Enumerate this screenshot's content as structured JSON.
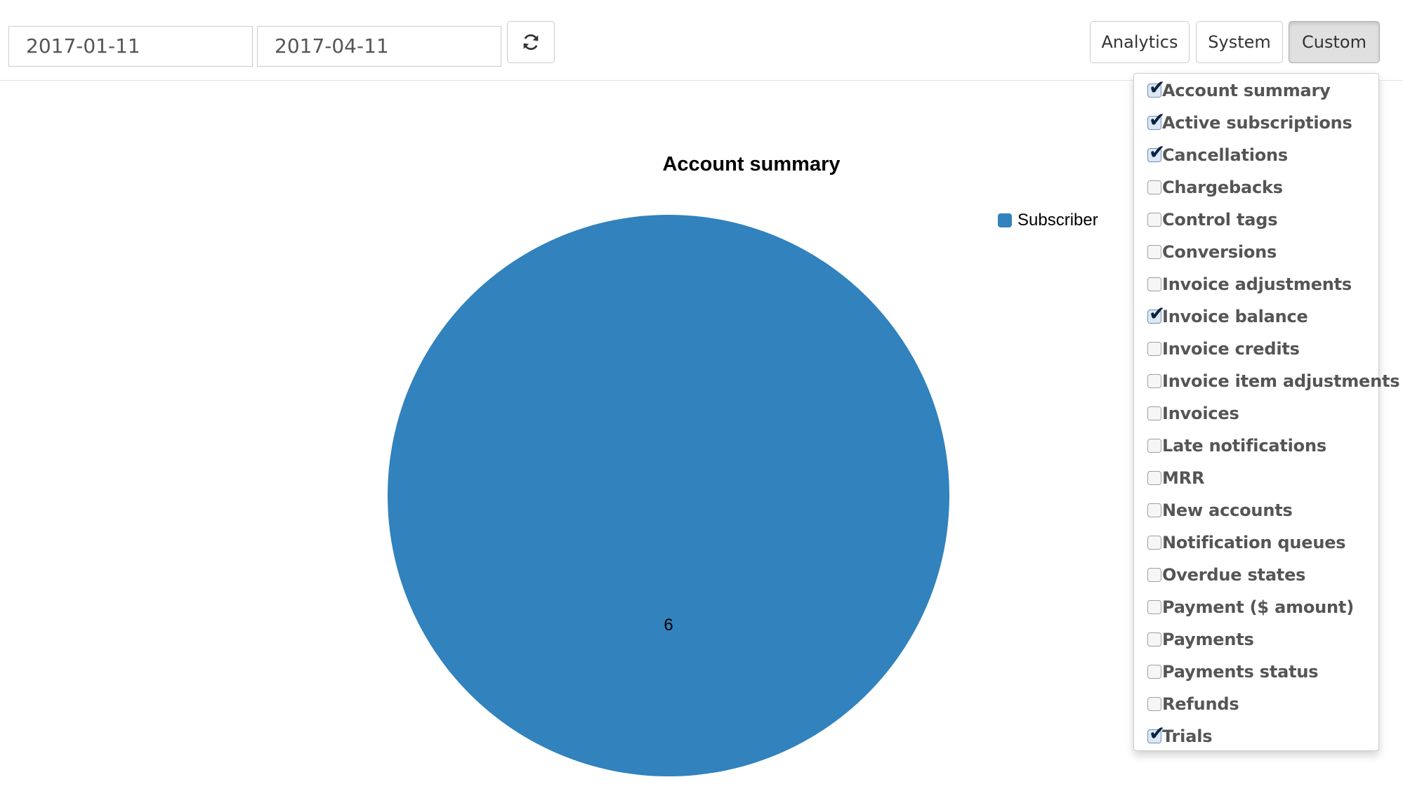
{
  "toolbar": {
    "start_date": "2017-01-11",
    "end_date": "2017-04-11",
    "refresh_icon": "refresh-icon",
    "tabs": [
      {
        "label": "Analytics",
        "active": false
      },
      {
        "label": "System",
        "active": false
      },
      {
        "label": "Custom",
        "active": true
      }
    ]
  },
  "colors": {
    "slice": "#3182bd",
    "dropdown_text": "#555555",
    "check_mark": "#0b2340"
  },
  "chart_data": {
    "type": "pie",
    "title": "Account summary",
    "categories": [
      "Subscriber"
    ],
    "values": [
      6
    ],
    "data_labels": [
      "6"
    ],
    "legend": {
      "placement": "top-right",
      "entries": [
        "Subscriber"
      ]
    }
  },
  "dropdown": {
    "items": [
      {
        "label": "Account summary",
        "checked": true
      },
      {
        "label": "Active subscriptions",
        "checked": true
      },
      {
        "label": "Cancellations",
        "checked": true
      },
      {
        "label": "Chargebacks",
        "checked": false
      },
      {
        "label": "Control tags",
        "checked": false
      },
      {
        "label": "Conversions",
        "checked": false
      },
      {
        "label": "Invoice adjustments",
        "checked": false
      },
      {
        "label": "Invoice balance",
        "checked": true
      },
      {
        "label": "Invoice credits",
        "checked": false
      },
      {
        "label": "Invoice item adjustments",
        "checked": false
      },
      {
        "label": "Invoices",
        "checked": false
      },
      {
        "label": "Late notifications",
        "checked": false
      },
      {
        "label": "MRR",
        "checked": false
      },
      {
        "label": "New accounts",
        "checked": false
      },
      {
        "label": "Notification queues",
        "checked": false
      },
      {
        "label": "Overdue states",
        "checked": false
      },
      {
        "label": "Payment ($ amount)",
        "checked": false
      },
      {
        "label": "Payments",
        "checked": false
      },
      {
        "label": "Payments status",
        "checked": false
      },
      {
        "label": "Refunds",
        "checked": false
      },
      {
        "label": "Trials",
        "checked": true
      }
    ]
  }
}
